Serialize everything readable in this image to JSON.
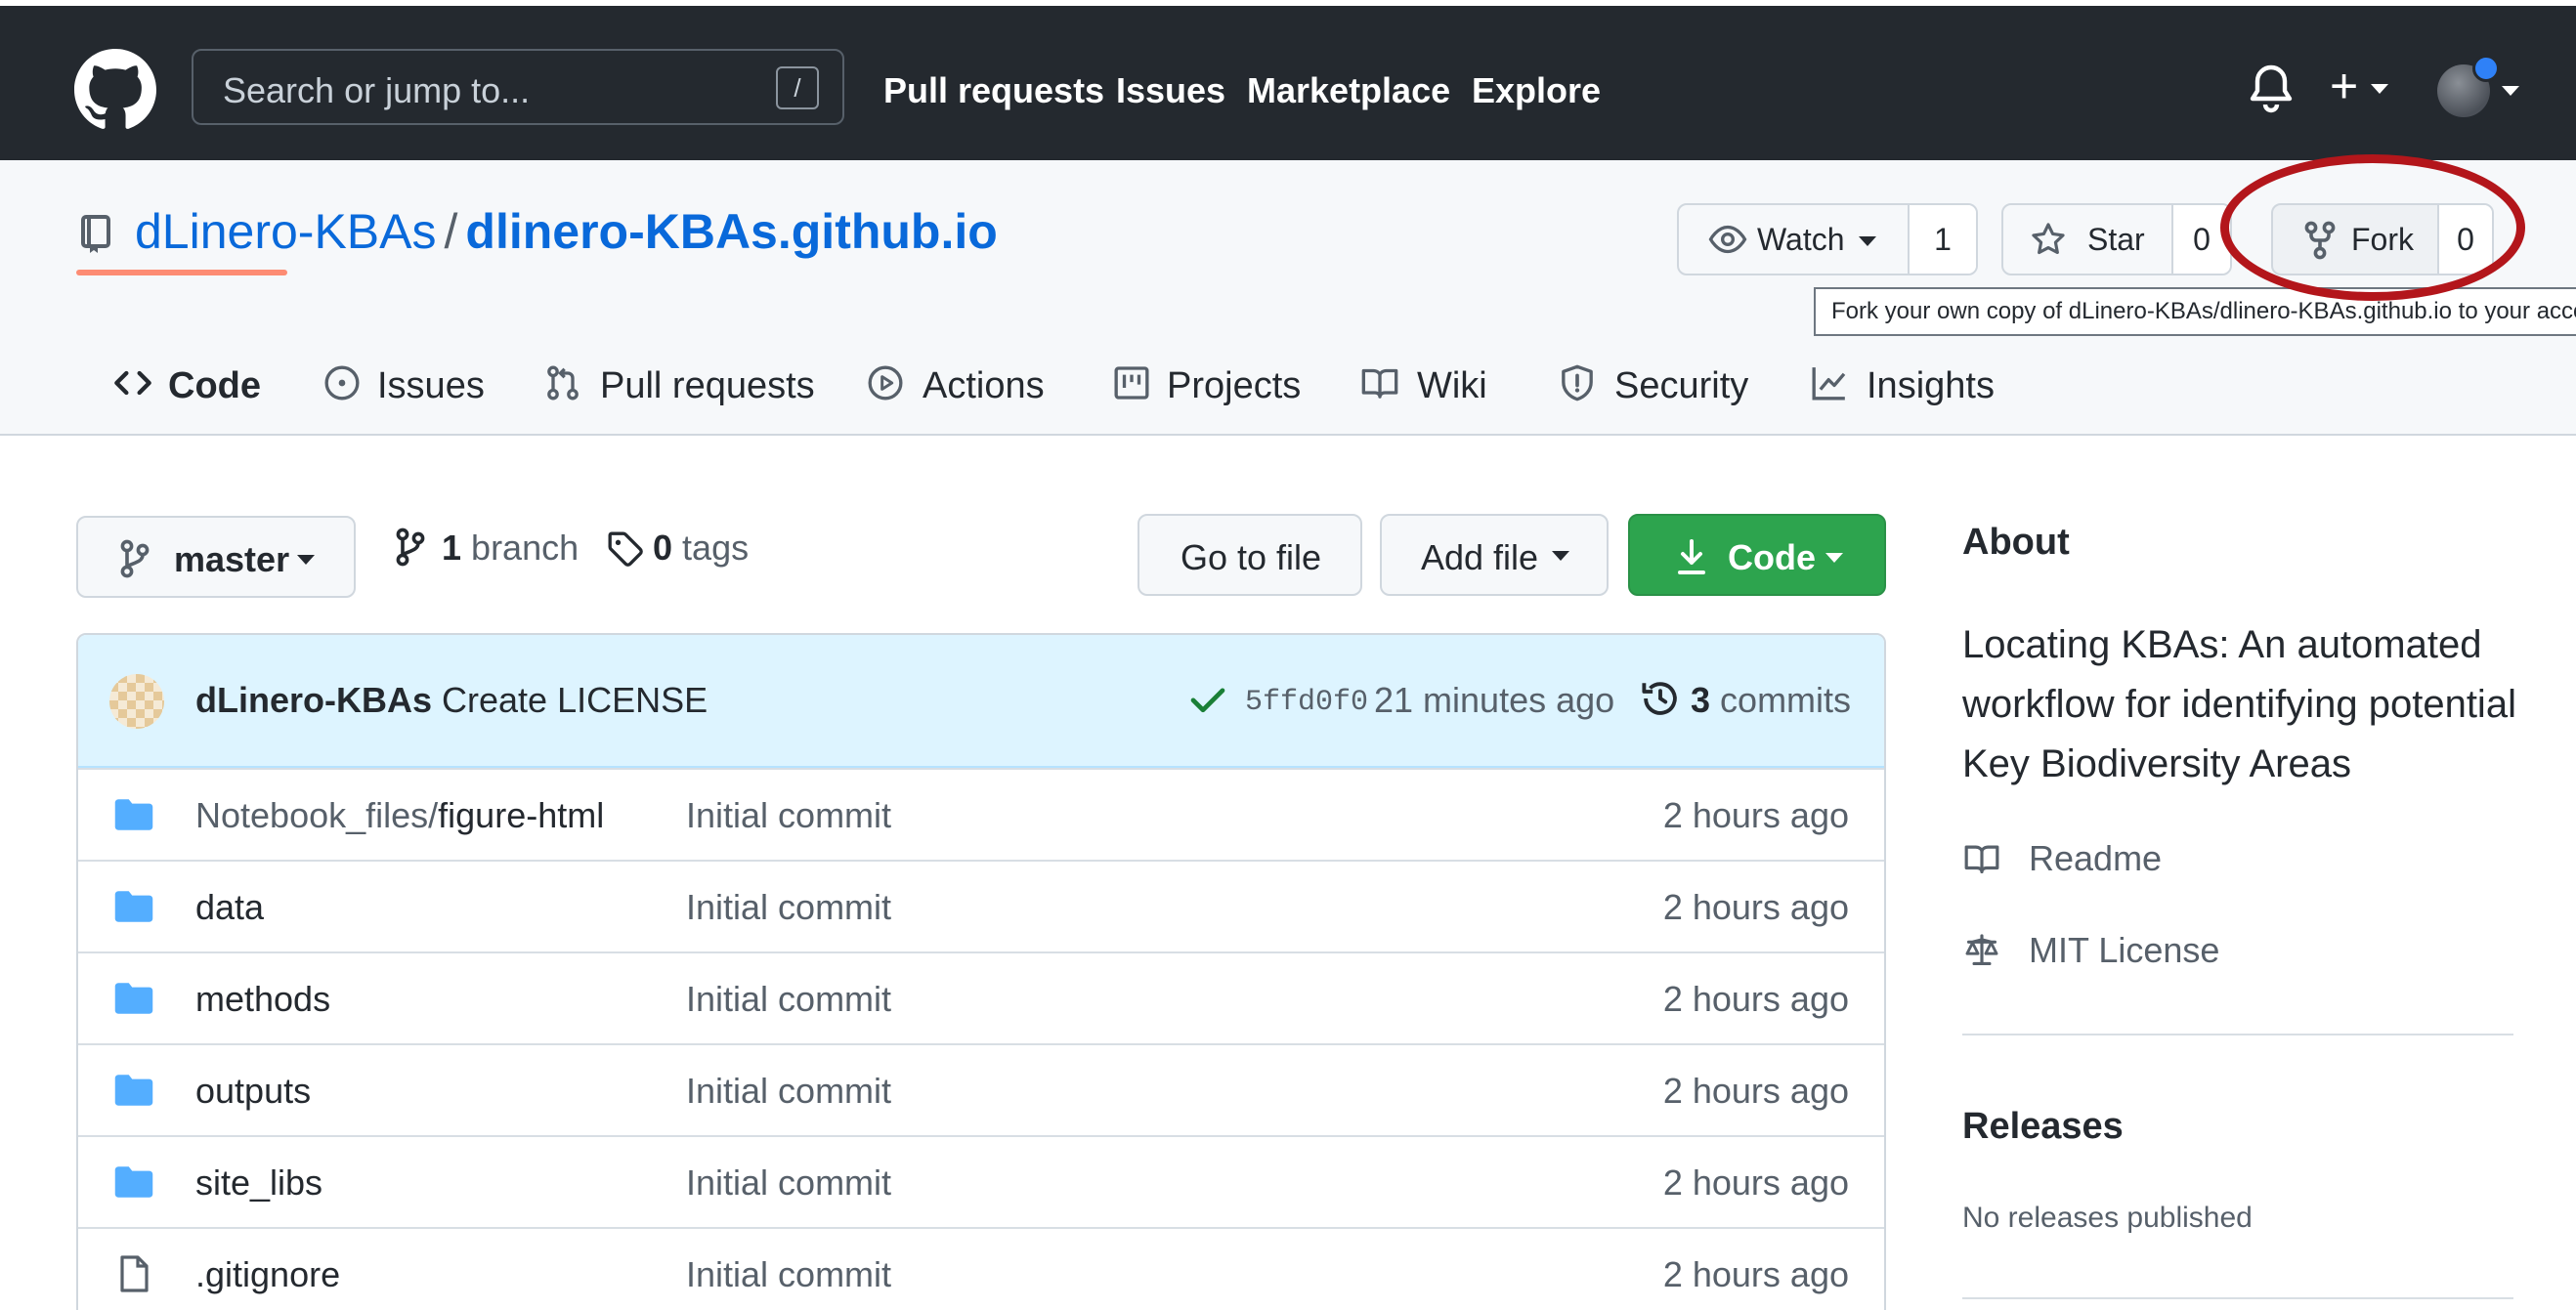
{
  "header": {
    "search_placeholder": "Search or jump to...",
    "slash_key": "/",
    "nav": [
      "Pull requests",
      "Issues",
      "Marketplace",
      "Explore"
    ],
    "plus_label": "+"
  },
  "repo": {
    "owner": "dLinero-KBAs",
    "separator": "/",
    "name": "dlinero-KBAs.github.io",
    "watch_label": "Watch",
    "watch_count": "1",
    "star_label": "Star",
    "star_count": "0",
    "fork_label": "Fork",
    "fork_count": "0",
    "fork_tooltip": "Fork your own copy of dLinero-KBAs/dlinero-KBAs.github.io to your account"
  },
  "tabs": [
    "Code",
    "Issues",
    "Pull requests",
    "Actions",
    "Projects",
    "Wiki",
    "Security",
    "Insights"
  ],
  "toolbar": {
    "branch_name": "master",
    "branch_count": "1",
    "branch_label": "branch",
    "tag_count": "0",
    "tag_label": "tags",
    "go_to_file": "Go to file",
    "add_file": "Add file",
    "code_button": "Code"
  },
  "latest_commit": {
    "author": "dLinero-KBAs",
    "message": "Create LICENSE",
    "sha": "5ffd0f0",
    "time": "21 minutes ago",
    "commit_count": "3",
    "commit_label": "commits"
  },
  "files": [
    {
      "type": "folder",
      "prefix": "Notebook_files/",
      "name": "figure-html",
      "message": "Initial commit",
      "time": "2 hours ago"
    },
    {
      "type": "folder",
      "prefix": "",
      "name": "data",
      "message": "Initial commit",
      "time": "2 hours ago"
    },
    {
      "type": "folder",
      "prefix": "",
      "name": "methods",
      "message": "Initial commit",
      "time": "2 hours ago"
    },
    {
      "type": "folder",
      "prefix": "",
      "name": "outputs",
      "message": "Initial commit",
      "time": "2 hours ago"
    },
    {
      "type": "folder",
      "prefix": "",
      "name": "site_libs",
      "message": "Initial commit",
      "time": "2 hours ago"
    },
    {
      "type": "file",
      "prefix": "",
      "name": ".gitignore",
      "message": "Initial commit",
      "time": "2 hours ago"
    }
  ],
  "about": {
    "heading": "About",
    "description": "Locating KBAs: An automated workflow for identifying potential Key Biodiversity Areas",
    "readme": "Readme",
    "license": "MIT License"
  },
  "releases": {
    "heading": "Releases",
    "subtitle": "No releases published"
  },
  "colors": {
    "header_bg": "#24292f",
    "link_blue": "#0969da",
    "green_button": "#2da44e",
    "highlight_ring": "#b3161b",
    "tab_underline": "#fd8c73"
  }
}
